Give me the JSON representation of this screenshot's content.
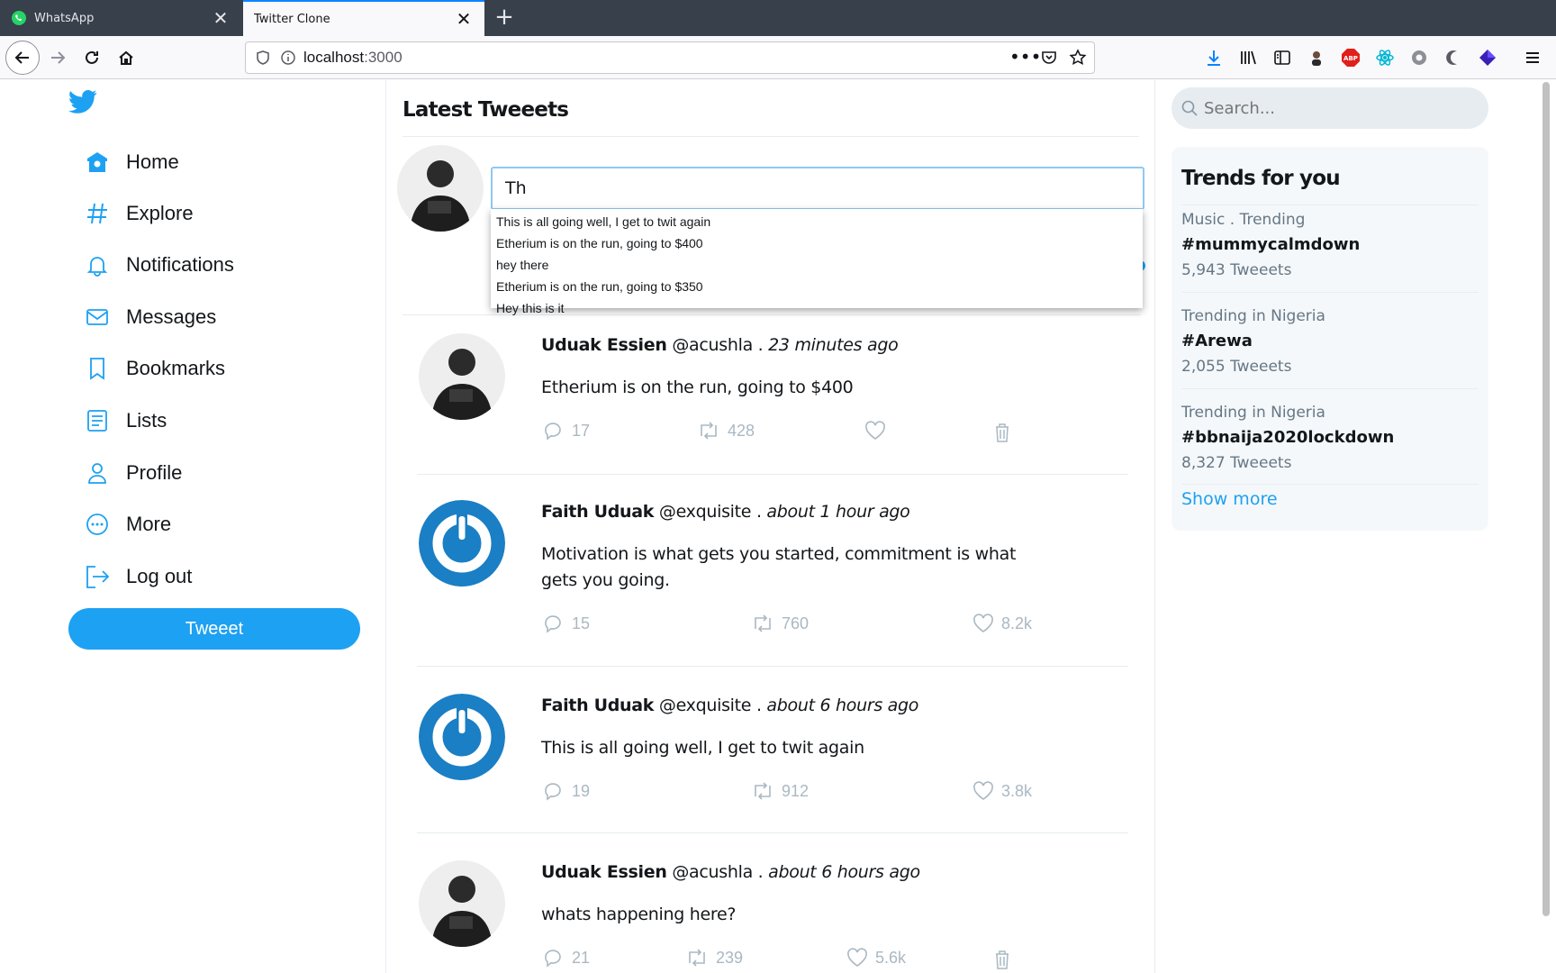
{
  "browser": {
    "tabs": [
      {
        "title": "WhatsApp",
        "active": false
      },
      {
        "title": "Twitter Clone",
        "active": true
      }
    ],
    "url_host": "localhost",
    "url_port": ":3000"
  },
  "sidebar": {
    "items": [
      {
        "label": "Home",
        "icon": "home-icon"
      },
      {
        "label": "Explore",
        "icon": "hash-icon"
      },
      {
        "label": "Notifications",
        "icon": "bell-icon"
      },
      {
        "label": "Messages",
        "icon": "mail-icon"
      },
      {
        "label": "Bookmarks",
        "icon": "bookmark-icon"
      },
      {
        "label": "Lists",
        "icon": "list-icon"
      },
      {
        "label": "Profile",
        "icon": "user-icon"
      },
      {
        "label": "More",
        "icon": "more-icon"
      },
      {
        "label": "Log out",
        "icon": "logout-icon"
      }
    ],
    "tweet_button": "Tweeet"
  },
  "main": {
    "title": "Latest Tweeets",
    "compose_value": "Th",
    "suggestions": [
      "This is all going well, I get to twit again",
      "Etherium is on the run, going to $400",
      "hey there",
      "Etherium is on the run, going to $350",
      "Hey this is it"
    ],
    "tweets": [
      {
        "name": "Uduak Essien",
        "handle": "@acushla",
        "when": "23 minutes ago",
        "text": "Etherium is on the run, going to $400",
        "replies": "17",
        "retweets": "428",
        "likes": "",
        "avatar": "photo"
      },
      {
        "name": "Faith Uduak",
        "handle": "@exquisite",
        "when": "about 1 hour ago",
        "text": "Motivation is what gets you started, commitment is what gets you going.",
        "replies": "15",
        "retweets": "760",
        "likes": "8.2k",
        "avatar": "power"
      },
      {
        "name": "Faith Uduak",
        "handle": "@exquisite",
        "when": "about 6 hours ago",
        "text": "This is all going well, I get to twit again",
        "replies": "19",
        "retweets": "912",
        "likes": "3.8k",
        "avatar": "power"
      },
      {
        "name": "Uduak Essien",
        "handle": "@acushla",
        "when": "about 6 hours ago",
        "text": "whats happening here?",
        "replies": "21",
        "retweets": "239",
        "likes": "5.6k",
        "avatar": "photo"
      }
    ]
  },
  "right": {
    "search_placeholder": "Search...",
    "trends_title": "Trends for you",
    "trends": [
      {
        "category": "Music . Trending",
        "tag": "#mummycalmdown",
        "count": "5,943 Tweeets"
      },
      {
        "category": "Trending in Nigeria",
        "tag": "#Arewa",
        "count": "2,055 Tweeets"
      },
      {
        "category": "Trending in Nigeria",
        "tag": "#bbnaija2020lockdown",
        "count": "8,327 Tweeets"
      }
    ],
    "show_more": "Show more"
  },
  "colors": {
    "accent": "#1da1f2",
    "text": "#14171a",
    "muted": "#657786",
    "icon_muted": "#aab8c2"
  }
}
